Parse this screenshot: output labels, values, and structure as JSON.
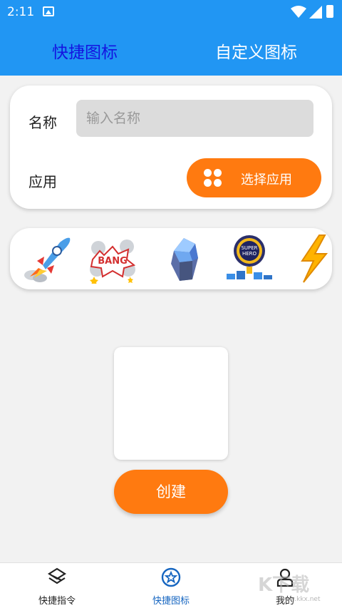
{
  "status_bar": {
    "time": "2:11"
  },
  "app_bar": {
    "tabs": [
      {
        "label": "快捷图标",
        "active": true
      },
      {
        "label": "自定义图标",
        "active": false
      }
    ]
  },
  "form": {
    "name_label": "名称",
    "name_placeholder": "输入名称",
    "app_label": "应用",
    "choose_app_button": "选择应用"
  },
  "icon_options": [
    "rocket-icon",
    "bang-icon",
    "crystal-icon",
    "super-hero-icon",
    "lightning-icon"
  ],
  "create_button": "创建",
  "bottom_nav": {
    "items": [
      {
        "label": "快捷指令",
        "icon": "shortcut-icon",
        "active": false
      },
      {
        "label": "快捷图标",
        "icon": "star-circle-icon",
        "active": true
      },
      {
        "label": "我的",
        "icon": "person-icon",
        "active": false
      }
    ]
  },
  "watermark": {
    "text": "K下载",
    "sub": "www.kkx.net"
  },
  "colors": {
    "primary": "#2196f3",
    "accent": "#ff7a10",
    "active_tab": "#1414e0"
  }
}
